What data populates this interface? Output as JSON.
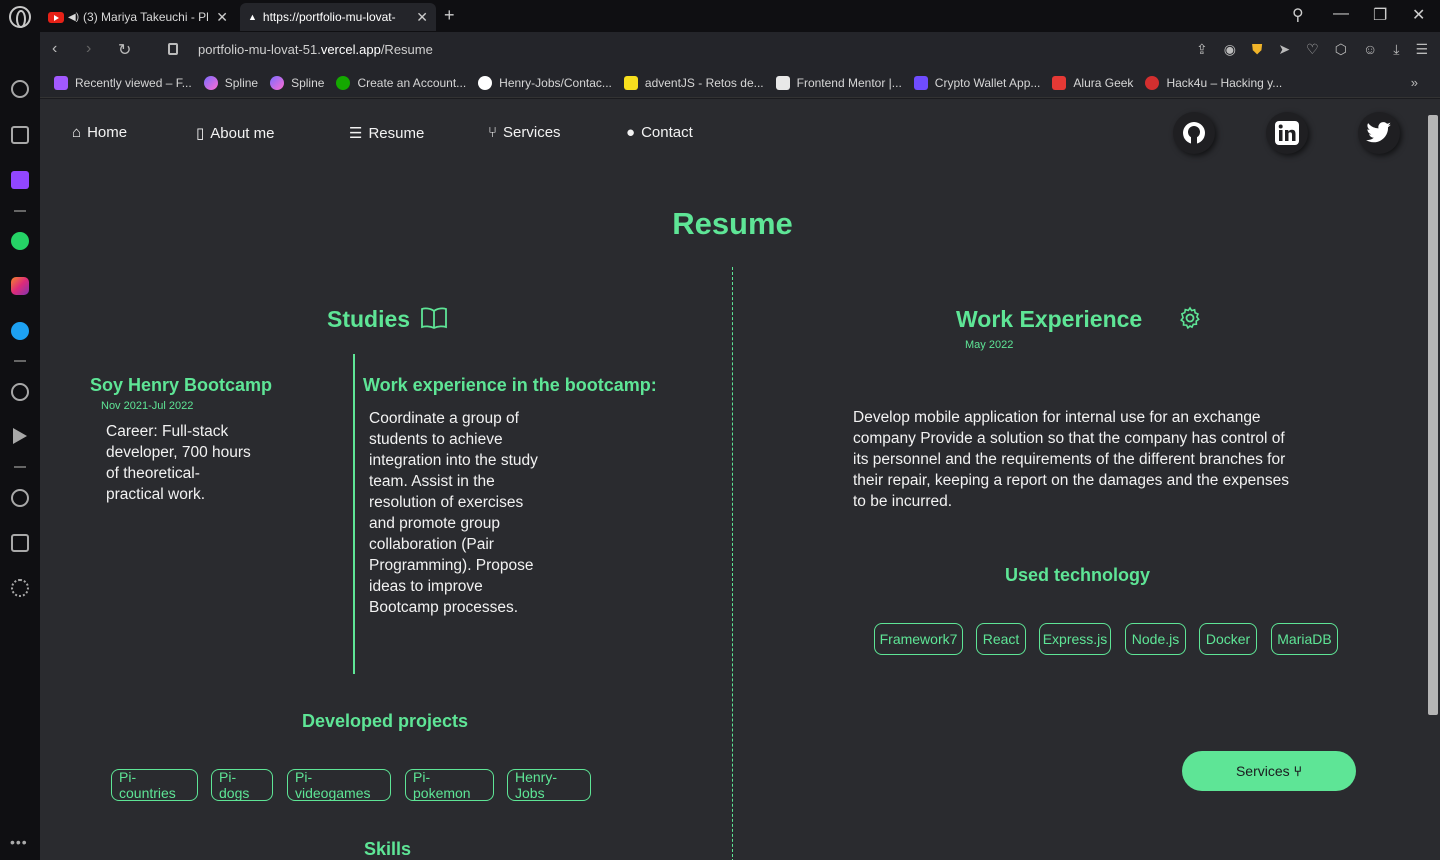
{
  "browser": {
    "tabs": [
      {
        "title": "(3) Mariya Takeuchi - Pl",
        "active": false
      },
      {
        "title": "https://portfolio-mu-lovat-",
        "active": true
      }
    ],
    "url_prefix": "portfolio-mu-lovat-51.",
    "url_domain": "vercel.app",
    "url_path": "/Resume",
    "bookmarks": [
      {
        "label": "Recently viewed – F...",
        "color": "#a259ff"
      },
      {
        "label": "Spline",
        "color": "#7b6cff"
      },
      {
        "label": "Spline",
        "color": "#7b6cff"
      },
      {
        "label": "Create an Account...",
        "color": "#14a800"
      },
      {
        "label": "Henry-Jobs/Contac...",
        "color": "#ffffff"
      },
      {
        "label": "adventJS - Retos de...",
        "color": "#f7df1e"
      },
      {
        "label": "Frontend Mentor |...",
        "color": "#e8e8e8"
      },
      {
        "label": "Crypto Wallet App...",
        "color": "#6f4cff"
      },
      {
        "label": "Alura Geek",
        "color": "#e53935"
      },
      {
        "label": "Hack4u – Hacking y...",
        "color": "#d32f2f"
      }
    ]
  },
  "nav": {
    "home": "Home",
    "about": "About me",
    "resume": "Resume",
    "services": "Services",
    "contact": "Contact"
  },
  "page": {
    "title": "Resume",
    "studies": {
      "heading": "Studies",
      "school": "Soy Henry Bootcamp",
      "dates": "Nov 2021-Jul 2022",
      "career_lines": [
        "Career: Full-stack",
        "developer, 700 hours",
        "of theoretical-",
        "practical work."
      ],
      "bootcamp_heading": "Work experience in the bootcamp:",
      "bootcamp_lines": [
        "Coordinate a group of",
        "students to achieve",
        "integration into the study",
        "team. Assist in the",
        "resolution of exercises",
        "and promote group",
        "collaboration (Pair",
        "Programming). Propose",
        "ideas to improve",
        "Bootcamp processes."
      ]
    },
    "projects": {
      "heading": "Developed projects",
      "items": [
        "Pi-countries",
        "Pi-dogs",
        "Pi-videogames",
        "Pi-pokemon",
        "Henry-Jobs"
      ]
    },
    "skills_heading": "Skills",
    "work": {
      "heading": "Work Experience",
      "date": "May 2022",
      "description_lines": [
        "Develop mobile application for internal use for an exchange",
        "company Provide a solution so that the company has control of",
        "its personnel and the requirements of the different branches for",
        "their repair, keeping a report on the damages and the expenses",
        "to be incurred."
      ],
      "tech_heading": "Used technology",
      "tech": [
        "Framework7",
        "React",
        "Express.js",
        "Node.js",
        "Docker",
        "MariaDB"
      ]
    },
    "services_button": "Services"
  },
  "colors": {
    "accent": "#5ee596",
    "page_bg": "#2a2b2f"
  }
}
